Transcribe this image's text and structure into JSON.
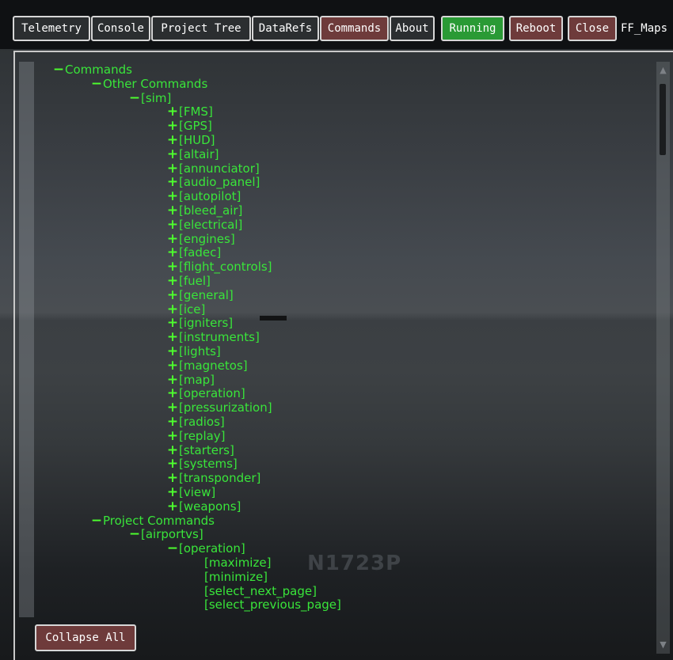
{
  "toolbar": {
    "tabs": [
      "Telemetry",
      "Console",
      "Project Tree",
      "DataRefs",
      "Commands",
      "About"
    ],
    "active_tab": "Commands",
    "running_label": "Running",
    "reboot_label": "Reboot",
    "close_label": "Close",
    "window_title": "FF_Maps"
  },
  "tree": [
    {
      "depth": 0,
      "marker": "minus",
      "label": "Commands"
    },
    {
      "depth": 1,
      "marker": "minus",
      "label": "Other Commands"
    },
    {
      "depth": 2,
      "marker": "minus",
      "label": "[sim]"
    },
    {
      "depth": 3,
      "marker": "plus",
      "label": "[FMS]"
    },
    {
      "depth": 3,
      "marker": "plus",
      "label": "[GPS]"
    },
    {
      "depth": 3,
      "marker": "plus",
      "label": "[HUD]"
    },
    {
      "depth": 3,
      "marker": "plus",
      "label": "[altair]"
    },
    {
      "depth": 3,
      "marker": "plus",
      "label": "[annunciator]"
    },
    {
      "depth": 3,
      "marker": "plus",
      "label": "[audio_panel]"
    },
    {
      "depth": 3,
      "marker": "plus",
      "label": "[autopilot]"
    },
    {
      "depth": 3,
      "marker": "plus",
      "label": "[bleed_air]"
    },
    {
      "depth": 3,
      "marker": "plus",
      "label": "[electrical]"
    },
    {
      "depth": 3,
      "marker": "plus",
      "label": "[engines]"
    },
    {
      "depth": 3,
      "marker": "plus",
      "label": "[fadec]"
    },
    {
      "depth": 3,
      "marker": "plus",
      "label": "[flight_controls]"
    },
    {
      "depth": 3,
      "marker": "plus",
      "label": "[fuel]"
    },
    {
      "depth": 3,
      "marker": "plus",
      "label": "[general]"
    },
    {
      "depth": 3,
      "marker": "plus",
      "label": "[ice]"
    },
    {
      "depth": 3,
      "marker": "plus",
      "label": "[igniters]"
    },
    {
      "depth": 3,
      "marker": "plus",
      "label": "[instruments]"
    },
    {
      "depth": 3,
      "marker": "plus",
      "label": "[lights]"
    },
    {
      "depth": 3,
      "marker": "plus",
      "label": "[magnetos]"
    },
    {
      "depth": 3,
      "marker": "plus",
      "label": "[map]"
    },
    {
      "depth": 3,
      "marker": "plus",
      "label": "[operation]"
    },
    {
      "depth": 3,
      "marker": "plus",
      "label": "[pressurization]"
    },
    {
      "depth": 3,
      "marker": "plus",
      "label": "[radios]"
    },
    {
      "depth": 3,
      "marker": "plus",
      "label": "[replay]"
    },
    {
      "depth": 3,
      "marker": "plus",
      "label": "[starters]"
    },
    {
      "depth": 3,
      "marker": "plus",
      "label": "[systems]"
    },
    {
      "depth": 3,
      "marker": "plus",
      "label": "[transponder]"
    },
    {
      "depth": 3,
      "marker": "plus",
      "label": "[view]"
    },
    {
      "depth": 3,
      "marker": "plus",
      "label": "[weapons]"
    },
    {
      "depth": 1,
      "marker": "minus",
      "label": "Project Commands"
    },
    {
      "depth": 2,
      "marker": "minus",
      "label": "[airportvs]"
    },
    {
      "depth": 3,
      "marker": "minus",
      "label": "[operation]"
    },
    {
      "depth": 4,
      "marker": "none",
      "label": "[maximize]"
    },
    {
      "depth": 4,
      "marker": "none",
      "label": "[minimize]"
    },
    {
      "depth": 4,
      "marker": "none",
      "label": "[select_next_page]"
    },
    {
      "depth": 4,
      "marker": "none",
      "label": "[select_previous_page]"
    }
  ],
  "footer": {
    "collapse_all_label": "Collapse All"
  },
  "background": {
    "tail_number": "N1723P"
  },
  "icons": {
    "minus": "−",
    "plus": "+",
    "scroll_up": "▲",
    "scroll_down": "▼"
  },
  "colors": {
    "tree_text": "#39e53a",
    "button_red": "#6e3b3b",
    "button_green": "#2a9a35"
  }
}
